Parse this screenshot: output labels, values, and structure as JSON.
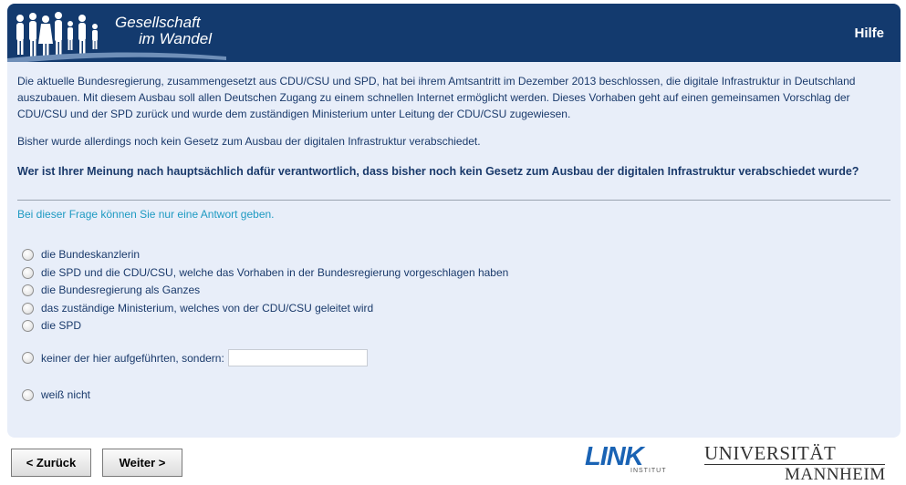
{
  "header": {
    "brand_line1": "Gesellschaft",
    "brand_line2": "im Wandel",
    "help_label": "Hilfe"
  },
  "intro": {
    "paragraph1": "Die aktuelle Bundesregierung, zusammengesetzt aus CDU/CSU und SPD, hat bei ihrem Amtsantritt im Dezember 2013 beschlossen, die digitale Infrastruktur in Deutschland auszubauen. Mit diesem Ausbau soll allen Deutschen Zugang zu einem schnellen Internet ermöglicht werden. Dieses Vorhaben geht auf einen gemeinsamen Vorschlag der CDU/CSU und der SPD zurück und wurde dem zuständigen Ministerium unter Leitung der CDU/CSU zugewiesen.",
    "paragraph2": "Bisher wurde allerdings noch kein Gesetz zum Ausbau der digitalen Infrastruktur verabschiedet."
  },
  "question": {
    "text": "Wer ist Ihrer Meinung nach hauptsächlich dafür verantwortlich, dass bisher noch kein Gesetz zum Ausbau der digitalen Infrastruktur verabschiedet wurde?",
    "hint": "Bei dieser Frage können Sie nur eine Antwort geben."
  },
  "options": [
    {
      "label": "die Bundeskanzlerin",
      "selected": false
    },
    {
      "label": "die SPD und die CDU/CSU, welche das Vorhaben in der Bundesregierung vorgeschlagen haben",
      "selected": false
    },
    {
      "label": "die Bundesregierung als Ganzes",
      "selected": false
    },
    {
      "label": "das zuständige Ministerium, welches von der CDU/CSU geleitet wird",
      "selected": false
    },
    {
      "label": "die SPD",
      "selected": false
    },
    {
      "label": "keiner der hier aufgeführten, sondern:",
      "selected": false,
      "input_value": ""
    },
    {
      "label": "weiß nicht",
      "selected": false
    }
  ],
  "nav": {
    "back_label": "< Zurück",
    "next_label": "Weiter >"
  },
  "logos": {
    "link_name": "LINK",
    "link_sub": "INSTITUT",
    "university_line1": "UNIVERSITÄT",
    "university_line2": "MANNHEIM"
  },
  "colors": {
    "header_bg": "#133a6e",
    "content_bg": "#e8eef9",
    "text": "#1a3a6b",
    "hint": "#1e9ac2",
    "link_blue": "#1a63b4"
  }
}
